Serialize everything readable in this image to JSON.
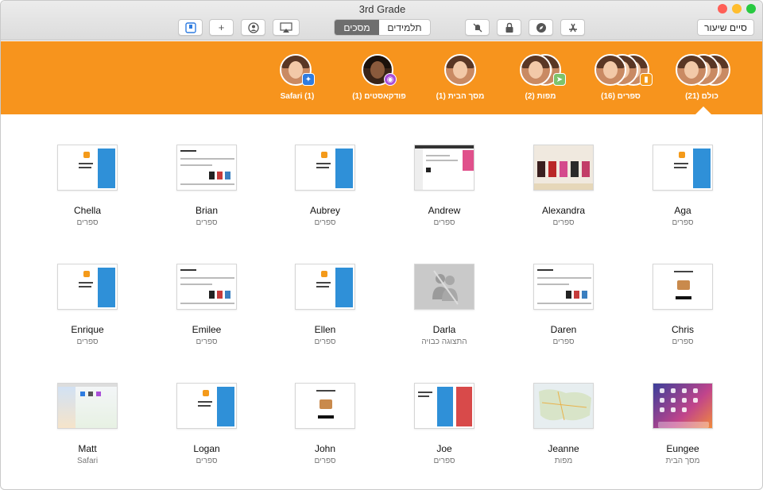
{
  "window": {
    "title": "3rd Grade"
  },
  "toolbar": {
    "tabs": {
      "screens": "מסכים",
      "students": "תלמידים"
    },
    "end_class": "סיים שיעור",
    "add_label": "+"
  },
  "groups": [
    {
      "label": "כולם (21)"
    },
    {
      "label": "ספרים (16)"
    },
    {
      "label": "מפות (2)"
    },
    {
      "label": "מסך הבית (1)"
    },
    {
      "label": "פודקאסטים (1)"
    },
    {
      "label": "Safari (1)"
    }
  ],
  "students": [
    {
      "name": "Aga",
      "app": "ספרים",
      "thumb": "books"
    },
    {
      "name": "Alexandra",
      "app": "ספרים",
      "thumb": "store"
    },
    {
      "name": "Andrew",
      "app": "ספרים",
      "thumb": "reading"
    },
    {
      "name": "Aubrey",
      "app": "ספרים",
      "thumb": "books"
    },
    {
      "name": "Brian",
      "app": "ספרים",
      "thumb": "reading"
    },
    {
      "name": "Chella",
      "app": "ספרים",
      "thumb": "books"
    },
    {
      "name": "Chris",
      "app": "ספרים",
      "thumb": "get"
    },
    {
      "name": "Daren",
      "app": "ספרים",
      "thumb": "reading"
    },
    {
      "name": "Darla",
      "app": "התצוגה כבויה",
      "thumb": "grey"
    },
    {
      "name": "Ellen",
      "app": "ספרים",
      "thumb": "books"
    },
    {
      "name": "Emilee",
      "app": "ספרים",
      "thumb": "reading"
    },
    {
      "name": "Enrique",
      "app": "ספרים",
      "thumb": "books"
    },
    {
      "name": "Eungee",
      "app": "מסך הבית",
      "thumb": "home"
    },
    {
      "name": "Jeanne",
      "app": "מפות",
      "thumb": "map"
    },
    {
      "name": "Joe",
      "app": "ספרים",
      "thumb": "books2"
    },
    {
      "name": "John",
      "app": "ספרים",
      "thumb": "get"
    },
    {
      "name": "Logan",
      "app": "ספרים",
      "thumb": "books"
    },
    {
      "name": "Matt",
      "app": "Safari",
      "thumb": "safari"
    }
  ],
  "colors": {
    "accent": "#f7941d",
    "active_tab": "#6e6e6e"
  }
}
